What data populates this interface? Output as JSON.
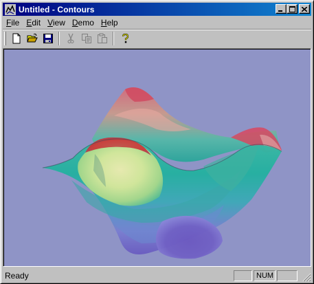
{
  "window": {
    "title": "Untitled - Contours",
    "app_icon": "contours-app-icon",
    "controls": [
      "minimize-icon",
      "maximize-icon",
      "close-icon"
    ]
  },
  "menu": {
    "items": [
      {
        "label": "File",
        "mnemonic": "F",
        "rest": "ile"
      },
      {
        "label": "Edit",
        "mnemonic": "E",
        "rest": "dit"
      },
      {
        "label": "View",
        "mnemonic": "V",
        "rest": "iew"
      },
      {
        "label": "Demo",
        "mnemonic": "D",
        "rest": "emo"
      },
      {
        "label": "Help",
        "mnemonic": "H",
        "rest": "elp"
      }
    ]
  },
  "toolbar": {
    "buttons": [
      {
        "icon": "new-document-icon",
        "enabled": true
      },
      {
        "icon": "open-folder-icon",
        "enabled": true
      },
      {
        "icon": "save-disk-icon",
        "enabled": true
      },
      {
        "icon": "cut-scissors-icon",
        "enabled": false
      },
      {
        "icon": "copy-icon",
        "enabled": false
      },
      {
        "icon": "paste-clipboard-icon",
        "enabled": false
      },
      {
        "icon": "help-question-icon",
        "enabled": true
      }
    ]
  },
  "view": {
    "background_color": "#8f94c6",
    "content": "3d-contour-surface"
  },
  "statusbar": {
    "text": "Ready",
    "num_indicator": "NUM"
  }
}
